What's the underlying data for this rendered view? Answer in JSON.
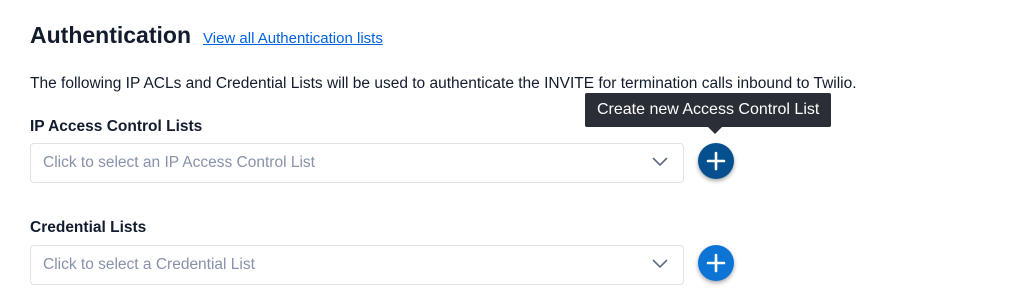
{
  "header": {
    "title": "Authentication",
    "view_all_link": "View all Authentication lists"
  },
  "description": "The following IP ACLs and Credential Lists will be used to authenticate the INVITE for termination calls inbound to Twilio.",
  "ip_acl": {
    "label": "IP Access Control Lists",
    "placeholder": "Click to select an IP Access Control List",
    "add_button_color": "#06508f"
  },
  "credential_lists": {
    "label": "Credential Lists",
    "placeholder": "Click to select a Credential List",
    "add_button_color": "#0b74d4"
  },
  "tooltip": {
    "text": "Create new Access Control List"
  },
  "icons": {
    "dropdown": "chevron-down-icon",
    "add": "plus-icon"
  }
}
